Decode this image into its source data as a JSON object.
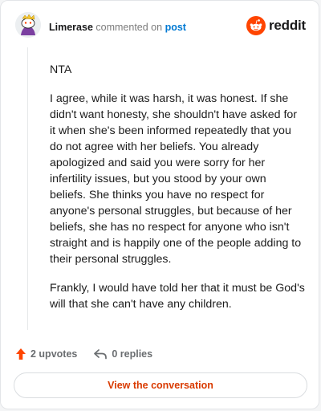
{
  "comment": {
    "username": "Limerase",
    "action_text": "commented on",
    "target_link": "post",
    "paragraphs": [
      "NTA",
      "I agree, while it was harsh, it was honest. If she didn't want honesty, she shouldn't have asked for it when she's been informed repeatedly that you do not agree with her beliefs. You already apologized and said you were sorry for her infertility issues, but you stood by your own beliefs. She thinks you have no respect for anyone's personal struggles, but because of her beliefs, she has no respect for anyone who isn't straight and is happily one of the people adding to their personal struggles.",
      "Frankly, I would have told her that it must be God's will that she can't have any children."
    ]
  },
  "brand": {
    "wordmark": "reddit",
    "icon": "reddit-snoo-icon",
    "color": "#ff4500"
  },
  "actions": {
    "upvotes": "2 upvotes",
    "replies": "0 replies",
    "upvote_icon": "upvote-arrow-icon",
    "reply_icon": "reply-arrow-icon",
    "upvote_color": "#ff4500"
  },
  "cta": {
    "label": "View the conversation",
    "color": "#d93a00"
  }
}
